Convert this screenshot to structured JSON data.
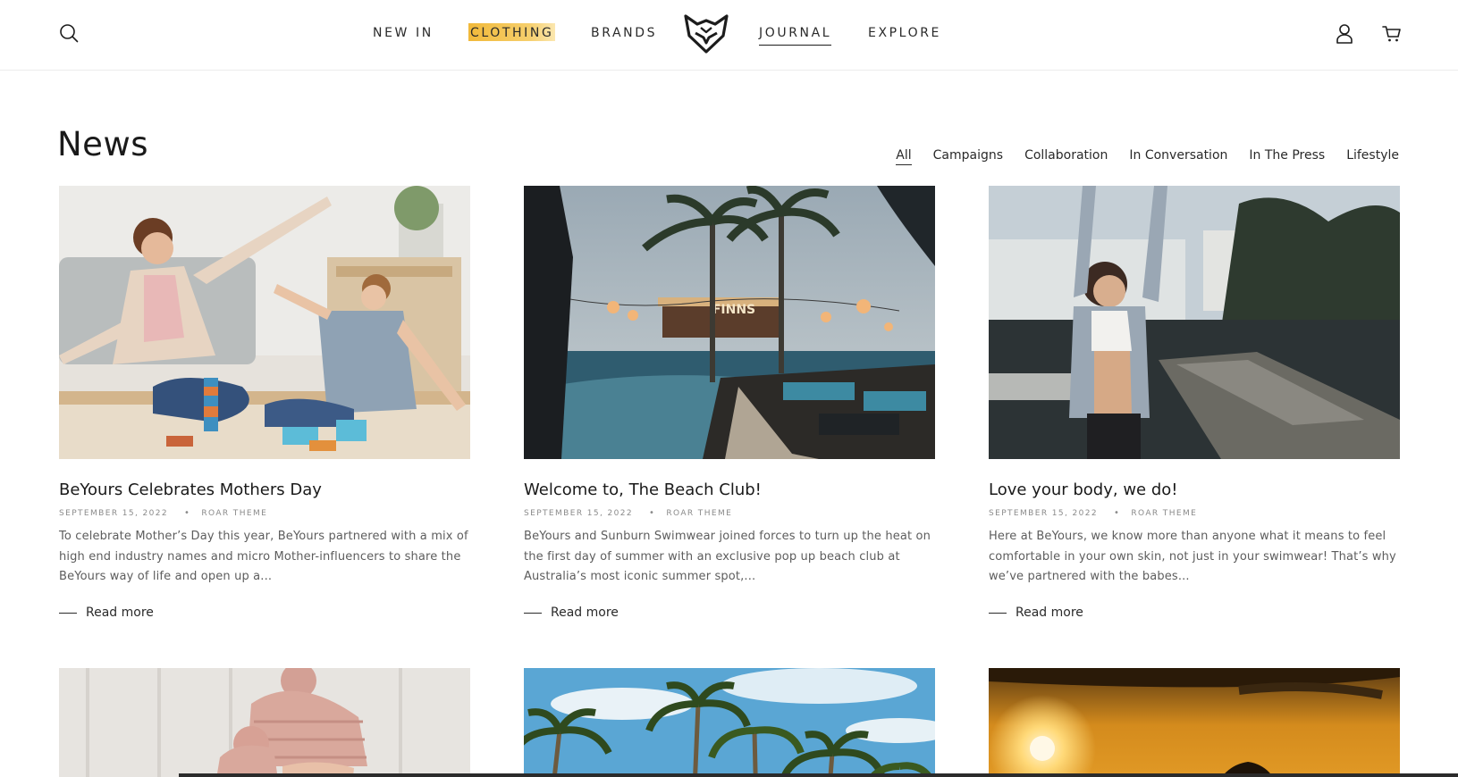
{
  "header": {
    "nav": [
      {
        "label": "NEW IN"
      },
      {
        "label": "CLOTHING"
      },
      {
        "label": "BRANDS"
      },
      {
        "label": "JOURNAL"
      },
      {
        "label": "EXPLORE"
      }
    ],
    "icons": [
      "search-icon",
      "fox-logo",
      "account-icon",
      "cart-icon"
    ],
    "highlight_color": "#f1b93a"
  },
  "page": {
    "title": "News",
    "filters": [
      {
        "label": "All",
        "active": true
      },
      {
        "label": "Campaigns"
      },
      {
        "label": "Collaboration"
      },
      {
        "label": "In Conversation"
      },
      {
        "label": "In The Press"
      },
      {
        "label": "Lifestyle"
      }
    ]
  },
  "articles": [
    {
      "title": "BeYours Celebrates Mothers Day",
      "date": "SEPTEMBER 15, 2022",
      "author": "ROAR THEME",
      "excerpt": "To celebrate Mother’s Day this year, BeYours partnered with a mix of high end industry names and micro Mother-influencers to share the BeYours way of life and open up a...",
      "read_more": "Read more"
    },
    {
      "title": "Welcome to, The Beach Club!",
      "date": "SEPTEMBER 15, 2022",
      "author": "ROAR THEME",
      "excerpt": "BeYours and Sunburn Swimwear joined forces to turn up the heat on the first day of summer with an exclusive pop up beach club at Australia’s most iconic summer spot,...",
      "read_more": "Read more",
      "sign_text": "FINNS"
    },
    {
      "title": "Love your body, we do!",
      "date": "SEPTEMBER 15, 2022",
      "author": "ROAR THEME",
      "excerpt": "Here at BeYours, we know more than anyone what it means to feel comfortable in your own skin, not just in your swimwear! That’s why we’ve partnered with the babes...",
      "read_more": "Read more"
    }
  ],
  "meta_separator": "•"
}
